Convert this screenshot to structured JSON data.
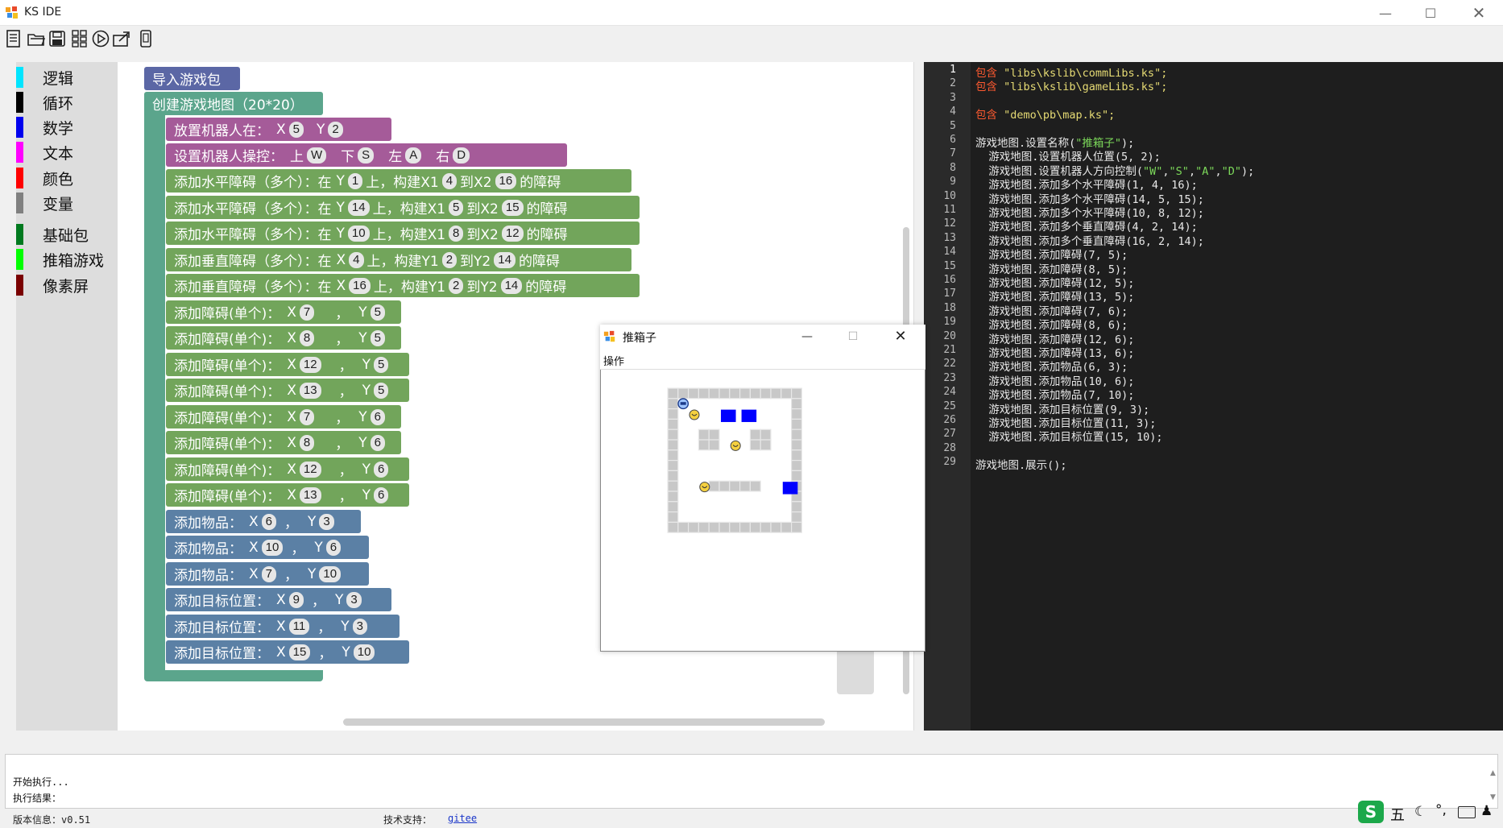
{
  "window": {
    "title": "KS IDE"
  },
  "toolbar": {
    "icons": [
      "new-file-icon",
      "open-file-icon",
      "save-icon",
      "blocks-icon",
      "run-icon",
      "export-icon",
      "device-icon"
    ]
  },
  "categories": [
    {
      "label": "逻辑",
      "color": "#00e5ff"
    },
    {
      "label": "循环",
      "color": "#000000"
    },
    {
      "label": "数学",
      "color": "#0000ee"
    },
    {
      "label": "文本",
      "color": "#ff00ff"
    },
    {
      "label": "颜色",
      "color": "#ff0000"
    },
    {
      "label": "变量",
      "color": "#808080"
    },
    {
      "label": "基础包",
      "color": "#007a1f"
    },
    {
      "label": "推箱游戏",
      "color": "#00ff00"
    },
    {
      "label": "像素屏",
      "color": "#7a0000"
    }
  ],
  "blocks": {
    "import": "导入游戏包",
    "create_map": "创建游戏地图（20*20）",
    "place_robot": {
      "label": "放置机器人在：",
      "x_label": "X",
      "x": "5",
      "y_label": "Y",
      "y": "2"
    },
    "set_controls": {
      "label": "设置机器人操控：",
      "up_label": "上",
      "up": "W",
      "down_label": "下",
      "down": "S",
      "left_label": "左",
      "left": "A",
      "right_label": "右",
      "right": "D"
    },
    "h_obstacles": [
      {
        "label": "添加水平障碍（多个）：在",
        "axis": "Y",
        "v": "1",
        "on": "上，构建X1",
        "a": "4",
        "to": "到X2",
        "b": "16",
        "end": "的障碍"
      },
      {
        "label": "添加水平障碍（多个）：在",
        "axis": "Y",
        "v": "14",
        "on": "上，构建X1",
        "a": "5",
        "to": "到X2",
        "b": "15",
        "end": "的障碍"
      },
      {
        "label": "添加水平障碍（多个）：在",
        "axis": "Y",
        "v": "10",
        "on": "上，构建X1",
        "a": "8",
        "to": "到X2",
        "b": "12",
        "end": "的障碍"
      }
    ],
    "v_obstacles": [
      {
        "label": "添加垂直障碍（多个）：在",
        "axis": "X",
        "v": "4",
        "on": "上，构建Y1",
        "a": "2",
        "to": "到Y2",
        "b": "14",
        "end": "的障碍"
      },
      {
        "label": "添加垂直障碍（多个）：在",
        "axis": "X",
        "v": "16",
        "on": "上，构建Y1",
        "a": "2",
        "to": "到Y2",
        "b": "14",
        "end": "的障碍"
      }
    ],
    "single_obstacles": [
      {
        "label": "添加障碍(单个)：",
        "x": "7",
        "y": "5"
      },
      {
        "label": "添加障碍(单个)：",
        "x": "8",
        "y": "5"
      },
      {
        "label": "添加障碍(单个)：",
        "x": "12",
        "y": "5"
      },
      {
        "label": "添加障碍(单个)：",
        "x": "13",
        "y": "5"
      },
      {
        "label": "添加障碍(单个)：",
        "x": "7",
        "y": "6"
      },
      {
        "label": "添加障碍(单个)：",
        "x": "8",
        "y": "6"
      },
      {
        "label": "添加障碍(单个)：",
        "x": "12",
        "y": "6"
      },
      {
        "label": "添加障碍(单个)：",
        "x": "13",
        "y": "6"
      }
    ],
    "items": [
      {
        "label": "添加物品：",
        "x": "6",
        "y": "3"
      },
      {
        "label": "添加物品：",
        "x": "10",
        "y": "6"
      },
      {
        "label": "添加物品：",
        "x": "7",
        "y": "10"
      }
    ],
    "targets": [
      {
        "label": "添加目标位置：",
        "x": "9",
        "y": "3"
      },
      {
        "label": "添加目标位置：",
        "x": "11",
        "y": "3"
      },
      {
        "label": "添加目标位置：",
        "x": "15",
        "y": "10"
      }
    ],
    "colors": {
      "import": "#5b67a5",
      "create": "#5ba58c",
      "purple": "#a55b99",
      "green": "#72a55b",
      "blue": "#5b80a5"
    }
  },
  "code": {
    "line_numbers": [
      "1",
      "2",
      "3",
      "4",
      "5",
      "6",
      "7",
      "8",
      "9",
      "10",
      "11",
      "12",
      "13",
      "14",
      "15",
      "16",
      "17",
      "18",
      "19",
      "20",
      "21",
      "22",
      "23",
      "24",
      "25",
      "26",
      "27",
      "28",
      "29"
    ],
    "lines": [
      {
        "kw": "包含",
        "rest": " \"libs\\kslib\\commLibs.ks\";"
      },
      {
        "kw": "包含",
        "rest": " \"libs\\kslib\\gameLibs.ks\";"
      },
      {
        "kw": "",
        "rest": ""
      },
      {
        "kw": "包含",
        "rest": " \"demo\\pb\\map.ks\";"
      },
      {
        "kw": "",
        "rest": ""
      },
      {
        "kw": "",
        "rest": "游戏地图.设置名称(\"推箱子\");"
      },
      {
        "kw": "",
        "rest": "  游戏地图.设置机器人位置(5, 2);"
      },
      {
        "kw": "",
        "rest": "  游戏地图.设置机器人方向控制(\"W\",\"S\",\"A\",\"D\");"
      },
      {
        "kw": "",
        "rest": "  游戏地图.添加多个水平障碍(1, 4, 16);"
      },
      {
        "kw": "",
        "rest": "  游戏地图.添加多个水平障碍(14, 5, 15);"
      },
      {
        "kw": "",
        "rest": "  游戏地图.添加多个水平障碍(10, 8, 12);"
      },
      {
        "kw": "",
        "rest": "  游戏地图.添加多个垂直障碍(4, 2, 14);"
      },
      {
        "kw": "",
        "rest": "  游戏地图.添加多个垂直障碍(16, 2, 14);"
      },
      {
        "kw": "",
        "rest": "  游戏地图.添加障碍(7, 5);"
      },
      {
        "kw": "",
        "rest": "  游戏地图.添加障碍(8, 5);"
      },
      {
        "kw": "",
        "rest": "  游戏地图.添加障碍(12, 5);"
      },
      {
        "kw": "",
        "rest": "  游戏地图.添加障碍(13, 5);"
      },
      {
        "kw": "",
        "rest": "  游戏地图.添加障碍(7, 6);"
      },
      {
        "kw": "",
        "rest": "  游戏地图.添加障碍(8, 6);"
      },
      {
        "kw": "",
        "rest": "  游戏地图.添加障碍(12, 6);"
      },
      {
        "kw": "",
        "rest": "  游戏地图.添加障碍(13, 6);"
      },
      {
        "kw": "",
        "rest": "  游戏地图.添加物品(6, 3);"
      },
      {
        "kw": "",
        "rest": "  游戏地图.添加物品(10, 6);"
      },
      {
        "kw": "",
        "rest": "  游戏地图.添加物品(7, 10);"
      },
      {
        "kw": "",
        "rest": "  游戏地图.添加目标位置(9, 3);"
      },
      {
        "kw": "",
        "rest": "  游戏地图.添加目标位置(11, 3);"
      },
      {
        "kw": "",
        "rest": "  游戏地图.添加目标位置(15, 10);"
      },
      {
        "kw": "",
        "rest": ""
      },
      {
        "kw": "",
        "rest": "游戏地图.展示();"
      }
    ]
  },
  "console": {
    "line1": "开始执行...",
    "line2": "执行结果："
  },
  "status": {
    "version": "版本信息：v0.51",
    "support_label": "技术支持：",
    "support_link": "gitee"
  },
  "game_window": {
    "title": "推箱子",
    "menu": "操作"
  },
  "tray": {
    "icons": [
      "ime-s-icon",
      "wu-text",
      "moon-icon",
      "punct-icon",
      "keyboard-icon",
      "user-icon"
    ],
    "wu": "五"
  },
  "colors": {
    "code_bg": "#1e1e1e",
    "keyword": "#ff5a30",
    "string": "#e6db74",
    "target_box": "#0000ff"
  }
}
